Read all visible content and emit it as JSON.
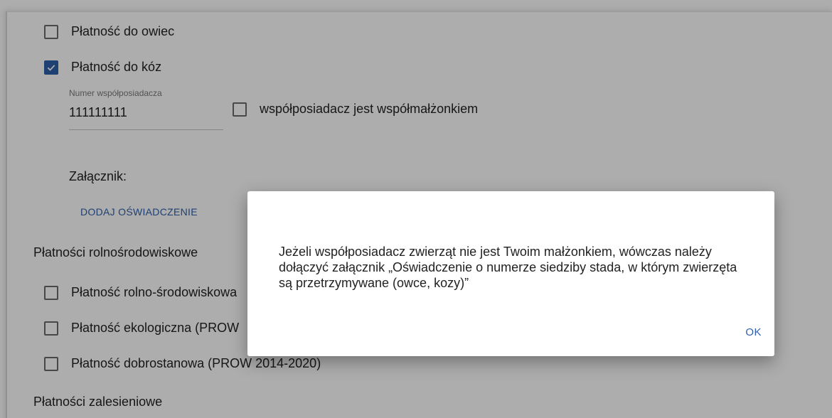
{
  "form": {
    "items": [
      {
        "label": "Płatność do owiec",
        "checked": false
      },
      {
        "label": "Płatność do kóz",
        "checked": true
      }
    ],
    "co_owner": {
      "field_label": "Numer współposiadacza",
      "field_value": "111111111",
      "spouse_label": "współposiadacz jest współmałżonkiem",
      "spouse_checked": false
    },
    "attachment": {
      "label": "Załącznik:",
      "add_button": "DODAJ OŚWIADCZENIE"
    },
    "agri_env": {
      "heading": "Płatności rolnośrodowiskowe",
      "items": [
        {
          "label": "Płatność rolno-środowiskowa",
          "checked": false
        },
        {
          "label": "Płatność ekologiczna (PROW",
          "checked": false
        },
        {
          "label": "Płatność dobrostanowa (PROW 2014-2020)",
          "checked": false
        }
      ]
    },
    "forest": {
      "heading": "Płatności zalesieniowe"
    }
  },
  "dialog": {
    "message": "Jeżeli współposiadacz zwierząt nie jest Twoim małżonkiem, wówczas należy dołączyć załącznik „Oświadczenie o numerze siedziby stada, w którym zwierzęta są przetrzymywane (owce, kozy)”",
    "ok_label": "OK"
  },
  "colors": {
    "accent": "#2e5fa8",
    "overlay": "rgba(0,0,0,0.32)"
  }
}
